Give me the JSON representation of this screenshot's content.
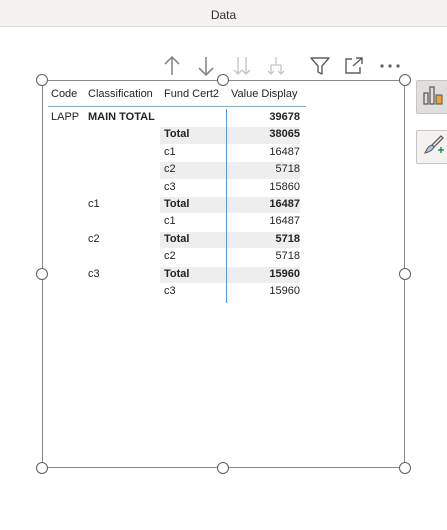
{
  "top_bar": {
    "title": "Data"
  },
  "toolbar": {
    "icons": [
      "arrow-up-icon",
      "arrow-down-icon",
      "expand-all-down-icon",
      "drill-down-icon",
      "filter-icon",
      "focus-mode-icon",
      "more-options-icon"
    ]
  },
  "matrix": {
    "headers": {
      "code": "Code",
      "classification": "Classification",
      "fund": "Fund Cert2",
      "value": "Value Display"
    },
    "rows": [
      {
        "code": "LAPP",
        "classification": "MAIN TOTAL",
        "fund": "",
        "value": "39678",
        "bold": true,
        "shaded": false
      },
      {
        "code": "",
        "classification": "",
        "fund": "Total",
        "value": "38065",
        "bold": true,
        "shaded": true
      },
      {
        "code": "",
        "classification": "",
        "fund": "c1",
        "value": "16487",
        "bold": false,
        "shaded": false
      },
      {
        "code": "",
        "classification": "",
        "fund": "c2",
        "value": "5718",
        "bold": false,
        "shaded": true
      },
      {
        "code": "",
        "classification": "",
        "fund": "c3",
        "value": "15860",
        "bold": false,
        "shaded": false
      },
      {
        "code": "",
        "classification": "c1",
        "fund": "Total",
        "value": "16487",
        "bold": true,
        "shaded": true
      },
      {
        "code": "",
        "classification": "",
        "fund": "c1",
        "value": "16487",
        "bold": false,
        "shaded": false
      },
      {
        "code": "",
        "classification": "c2",
        "fund": "Total",
        "value": "5718",
        "bold": true,
        "shaded": true
      },
      {
        "code": "",
        "classification": "",
        "fund": "c2",
        "value": "5718",
        "bold": false,
        "shaded": false
      },
      {
        "code": "",
        "classification": "c3",
        "fund": "Total",
        "value": "15960",
        "bold": true,
        "shaded": true
      },
      {
        "code": "",
        "classification": "",
        "fund": "c3",
        "value": "15960",
        "bold": false,
        "shaded": false
      }
    ]
  },
  "side_panel": {
    "buttons": [
      "build-visual-icon",
      "format-visual-icon"
    ]
  },
  "colors": {
    "accent_line": "#5b9bd5",
    "row_shade": "#eeeeee",
    "paint_accent": "#e8a33d"
  }
}
